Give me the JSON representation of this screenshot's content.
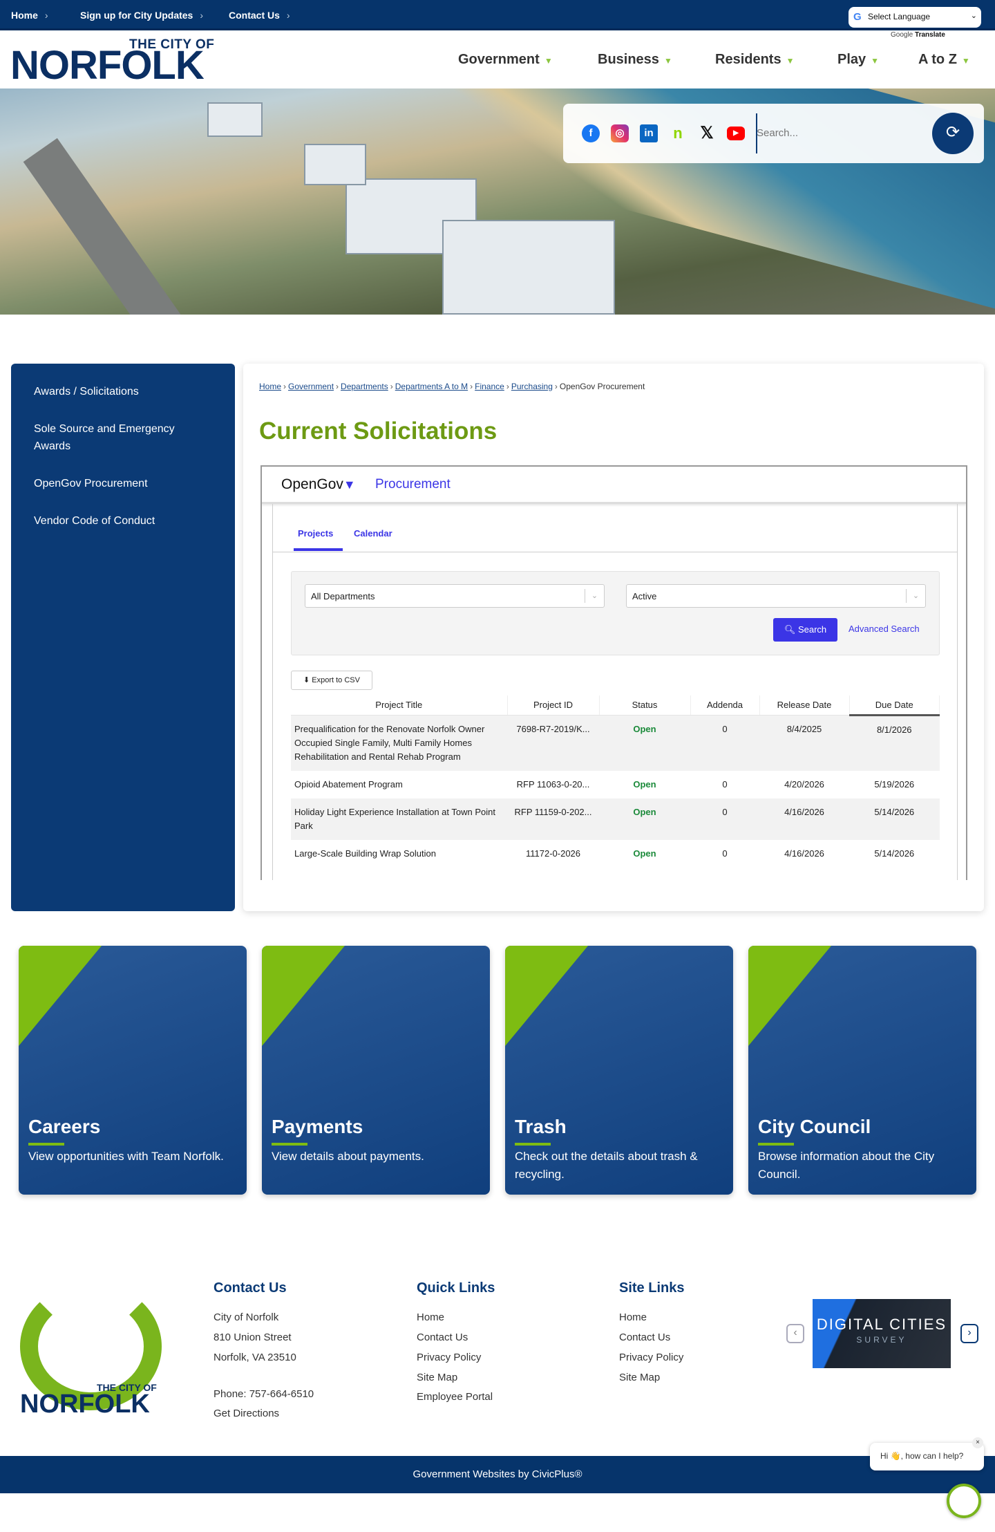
{
  "topbar": {
    "links": [
      "Home",
      "Sign up for City Updates",
      "Contact Us"
    ],
    "language": "Select Language",
    "google": "Google",
    "translate": "Translate"
  },
  "logo": {
    "line1": "THE CITY OF",
    "line2": "NORFOLK"
  },
  "nav": [
    "Government",
    "Business",
    "Residents",
    "Play",
    "A to Z"
  ],
  "search": {
    "placeholder": "Search..."
  },
  "social": [
    "facebook",
    "instagram",
    "linkedin",
    "nextdoor",
    "x",
    "youtube"
  ],
  "sidebar": [
    "Awards / Solicitations",
    "Sole Source and Emergency Awards",
    "OpenGov Procurement",
    "Vendor Code of Conduct"
  ],
  "breadcrumb": {
    "links": [
      "Home",
      "Government",
      "Departments",
      "Departments A to M",
      "Finance",
      "Purchasing"
    ],
    "current": "OpenGov Procurement"
  },
  "page_title": "Current Solicitations",
  "opengov": {
    "brand": "OpenGov",
    "product": "Procurement",
    "tabs": [
      "Projects",
      "Calendar"
    ],
    "department": "All Departments",
    "status": "Active",
    "search": "Search",
    "advanced": "Advanced Search",
    "export": "Export to CSV",
    "columns": [
      "Project Title",
      "Project ID",
      "Status",
      "Addenda",
      "Release Date",
      "Due Date"
    ],
    "rows": [
      [
        "Prequalification for the Renovate Norfolk Owner Occupied Single Family, Multi Family Homes Rehabilitation and Rental Rehab Program",
        "7698-R7-2019/K...",
        "Open",
        "0",
        "8/4/2025",
        "8/1/2026"
      ],
      [
        "Opioid Abatement Program",
        "RFP 11063-0-20...",
        "Open",
        "0",
        "4/20/2026",
        "5/19/2026"
      ],
      [
        "Holiday Light Experience Installation at Town Point Park",
        "RFP 11159-0-202...",
        "Open",
        "0",
        "4/16/2026",
        "5/14/2026"
      ],
      [
        "Large-Scale Building Wrap Solution",
        "11172-0-2026",
        "Open",
        "0",
        "4/16/2026",
        "5/14/2026"
      ]
    ]
  },
  "cards": [
    {
      "title": "Careers",
      "desc": "View opportunities with Team Norfolk."
    },
    {
      "title": "Payments",
      "desc": "View details about payments."
    },
    {
      "title": "Trash",
      "desc": "Check out the details about trash & recycling."
    },
    {
      "title": "City Council",
      "desc": "Browse information about the City Council."
    }
  ],
  "footer": {
    "contact": {
      "heading": "Contact Us",
      "lines": [
        "City of Norfolk",
        "810 Union Street",
        "Norfolk, VA 23510"
      ],
      "phone": "Phone: 757-664-6510",
      "directions": "Get Directions"
    },
    "quick": {
      "heading": "Quick Links",
      "links": [
        "Home",
        "Contact Us",
        "Privacy Policy",
        "Site Map",
        "Employee Portal"
      ]
    },
    "site": {
      "heading": "Site Links",
      "links": [
        "Home",
        "Contact Us",
        "Privacy Policy",
        "Site Map"
      ]
    },
    "award": {
      "title": "DIGITAL CITIES",
      "sub": "SURVEY"
    },
    "credit": "Government Websites by CivicPlus®"
  },
  "chat": {
    "greeting": "Hi 👋, how can I help?",
    "close": "×"
  }
}
